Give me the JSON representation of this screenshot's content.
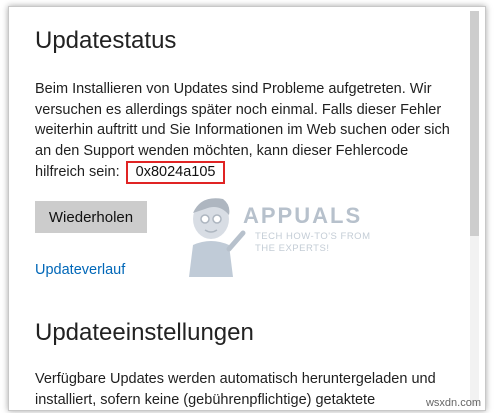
{
  "update_status": {
    "title": "Updatestatus",
    "message_before_code": "Beim Installieren von Updates sind Probleme aufgetreten. Wir versuchen es allerdings später noch einmal. Falls dieser Fehler weiterhin auftritt und Sie Informationen im Web suchen oder sich an den Support wenden möchten, kann dieser Fehlercode hilfreich sein:",
    "error_code": "0x8024a105",
    "retry_button": "Wiederholen",
    "history_link": "Updateverlauf"
  },
  "update_settings": {
    "title": "Updateeinstellungen",
    "message": "Verfügbare Updates werden automatisch heruntergeladen und installiert, sofern keine (gebührenpflichtige) getaktete"
  },
  "watermark": {
    "logo": "APPUALS",
    "tagline_line1": "TECH HOW-TO'S FROM",
    "tagline_line2": "THE EXPERTS!"
  },
  "site_mark": "wsxdn.com",
  "colors": {
    "accent_link": "#0067b8",
    "highlight_border": "#e02424",
    "button_bg": "#cccccc"
  }
}
